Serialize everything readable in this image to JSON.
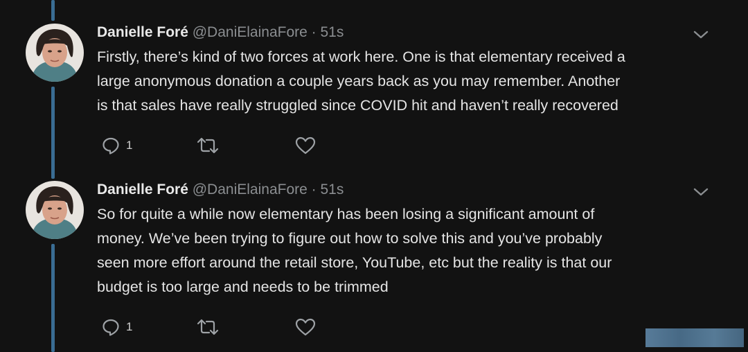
{
  "tweets": [
    {
      "author_name": "Danielle Foré",
      "handle": "@DaniElainaFore",
      "separator": "·",
      "timestamp": "51s",
      "lines": [
        "Firstly, there’s kind of two forces at work here. One is that elementary received a",
        "large anonymous donation a couple years back as you may remember. Another",
        "is that sales have really struggled since COVID hit and haven’t really recovered"
      ],
      "reply_count": "1",
      "retweet_count": "",
      "like_count": ""
    },
    {
      "author_name": "Danielle Foré",
      "handle": "@DaniElainaFore",
      "separator": "·",
      "timestamp": "51s",
      "lines": [
        "So for quite a while now elementary has been losing a significant amount of",
        "money. We’ve been trying to figure out how to solve this and you’ve probably",
        "seen more effort around the retail store, YouTube, etc but the reality is that our",
        "budget is too large and needs to be trimmed"
      ],
      "reply_count": "1",
      "retweet_count": "",
      "like_count": ""
    }
  ],
  "colors": {
    "background": "#121212",
    "thread_line": "#3a6d93",
    "muted_text": "#8b8e91",
    "primary_text": "#e5e5e5"
  },
  "icons": [
    "reply-icon",
    "retweet-icon",
    "like-icon",
    "chevron-down-icon"
  ]
}
